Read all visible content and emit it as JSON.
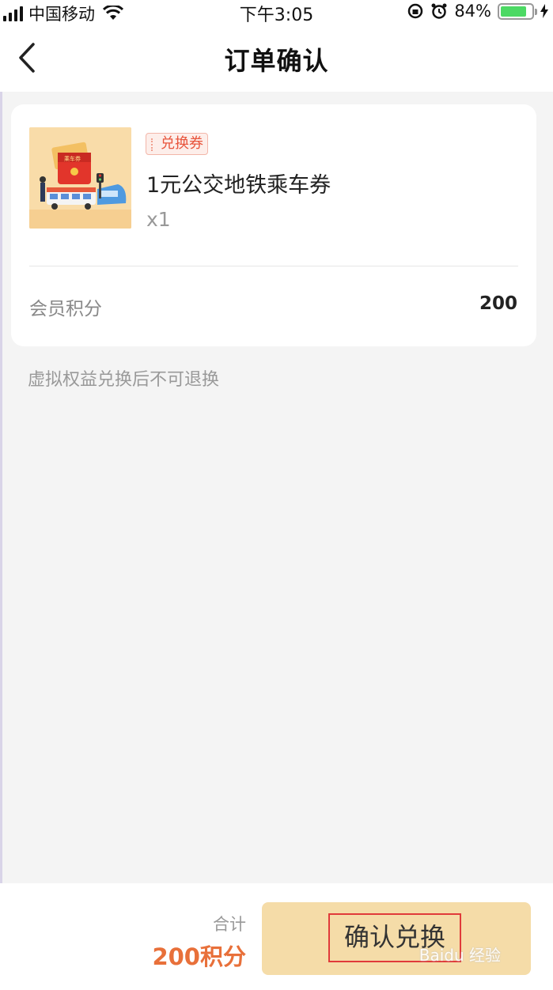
{
  "status_bar": {
    "carrier": "中国移动",
    "time": "下午3:05",
    "battery_percent_text": "84%",
    "battery_level": 0.84
  },
  "nav": {
    "title": "订单确认"
  },
  "product": {
    "badge": "兑换券",
    "name": "1元公交地铁乘车券",
    "quantity": "x1",
    "image_label": "乘车券"
  },
  "points": {
    "label": "会员积分",
    "value": "200"
  },
  "notice": "虚拟权益兑换后不可退换",
  "footer": {
    "total_label": "合计",
    "total_value": "200积分",
    "confirm_label": "确认兑换",
    "watermark": "Baidu 经验"
  },
  "colors": {
    "accent_orange": "#e8703a",
    "badge_red": "#e8553d",
    "button_bg": "#f5dca8",
    "battery_green": "#4cd964"
  }
}
